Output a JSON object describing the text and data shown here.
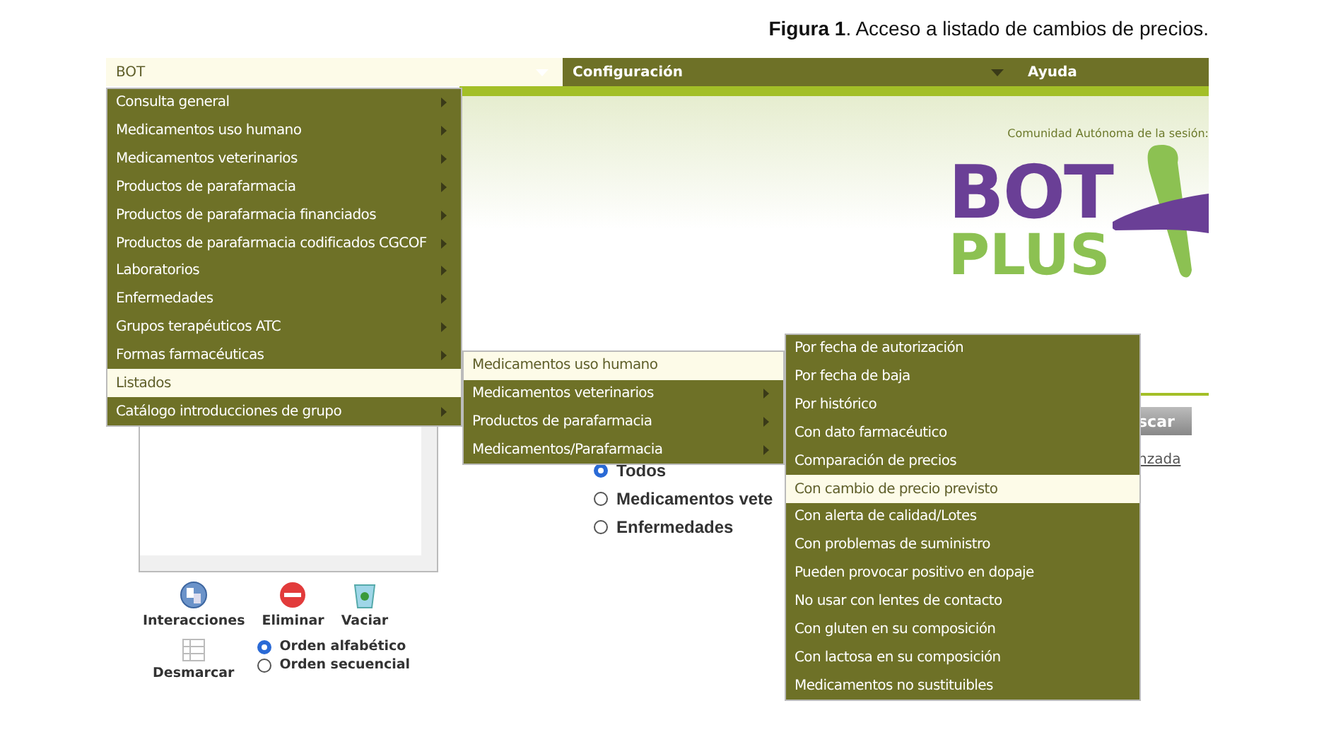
{
  "caption": "**Figura 1**. Acceso a listado de cambios de precios.",
  "menubar": [
    {
      "label": "BOT",
      "selected": true,
      "caret": true
    },
    {
      "label": "Configuración",
      "selected": false,
      "caret": true
    },
    {
      "label": "Ayuda",
      "selected": false,
      "caret": false
    }
  ],
  "header": {
    "session_label": "Comunidad Autónoma de la sesión:",
    "logo": {
      "line_1": "BOT",
      "line_2": "PLUS"
    }
  },
  "menus": [
    {
      "items": [
        {
          "label": "Consulta general",
          "selected": false,
          "arrow": true
        },
        {
          "label": "Medicamentos uso humano",
          "selected": false,
          "arrow": true
        },
        {
          "label": "Medicamentos veterinarios",
          "selected": false,
          "arrow": true
        },
        {
          "label": "Productos de parafarmacia",
          "selected": false,
          "arrow": true
        },
        {
          "label": "Productos de parafarmacia financiados",
          "selected": false,
          "arrow": true
        },
        {
          "label": "Productos de parafarmacia codificados CGCOF",
          "selected": false,
          "arrow": true
        },
        {
          "label": "Laboratorios",
          "selected": false,
          "arrow": true
        },
        {
          "label": "Enfermedades",
          "selected": false,
          "arrow": true
        },
        {
          "label": "Grupos terapéuticos ATC",
          "selected": false,
          "arrow": true
        },
        {
          "label": "Formas farmacéuticas",
          "selected": false,
          "arrow": true
        },
        {
          "label": "Listados",
          "selected": true,
          "arrow": false
        },
        {
          "label": "Catálogo introducciones de grupo",
          "selected": false,
          "arrow": true
        }
      ]
    },
    {
      "items": [
        {
          "label": "Medicamentos uso humano",
          "selected": true,
          "arrow": false
        },
        {
          "label": "Medicamentos veterinarios",
          "selected": false,
          "arrow": true
        },
        {
          "label": "Productos de parafarmacia",
          "selected": false,
          "arrow": true
        },
        {
          "label": "Medicamentos/Parafarmacia",
          "selected": false,
          "arrow": true
        }
      ]
    },
    {
      "items": [
        {
          "label": "Por fecha de autorización",
          "selected": false,
          "arrow": false
        },
        {
          "label": "Por fecha de baja",
          "selected": false,
          "arrow": false
        },
        {
          "label": "Por histórico",
          "selected": false,
          "arrow": false
        },
        {
          "label": "Con dato farmacéutico",
          "selected": false,
          "arrow": false
        },
        {
          "label": "Comparación de precios",
          "selected": false,
          "arrow": false
        },
        {
          "label": "Con cambio de precio previsto",
          "selected": true,
          "arrow": false
        },
        {
          "label": "Con alerta de calidad/Lotes",
          "selected": false,
          "arrow": false
        },
        {
          "label": "Con problemas de suministro",
          "selected": false,
          "arrow": false
        },
        {
          "label": "Pueden provocar positivo en dopaje",
          "selected": false,
          "arrow": false
        },
        {
          "label": "No usar con lentes de contacto",
          "selected": false,
          "arrow": false
        },
        {
          "label": "Con gluten en su composición",
          "selected": false,
          "arrow": false
        },
        {
          "label": "Con lactosa en su composición",
          "selected": false,
          "arrow": false
        },
        {
          "label": "Medicamentos no sustituibles",
          "selected": false,
          "arrow": false
        }
      ]
    }
  ],
  "search": {
    "button": "scar",
    "link": "nzada"
  },
  "type_options": [
    {
      "label": "Todos",
      "selected": true
    },
    {
      "label": "Medicamentos vete",
      "selected": false
    },
    {
      "label": "Enfermedades",
      "selected": false
    }
  ],
  "actions": [
    {
      "label": "Interacciones",
      "kind": "interactions"
    },
    {
      "label": "Eliminar",
      "kind": "delete"
    },
    {
      "label": "Vaciar",
      "kind": "empty"
    }
  ],
  "unmark": {
    "label": "Desmarcar"
  },
  "order_options": [
    {
      "label": "Orden alfabético",
      "selected": true
    },
    {
      "label": "Orden secuencial",
      "selected": false
    }
  ]
}
